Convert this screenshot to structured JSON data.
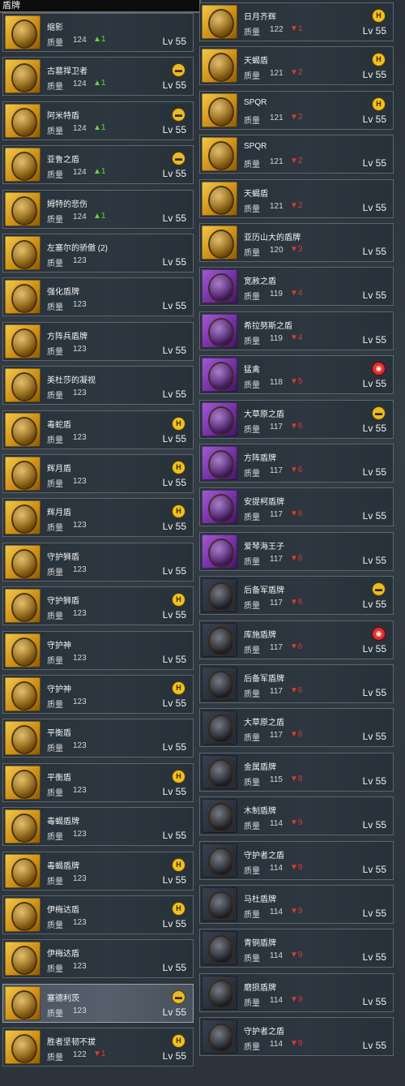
{
  "title": "盾牌",
  "quality_label": "质量",
  "left_items": [
    {
      "name": "缩影",
      "quality": "124",
      "delta": "▲1",
      "dir": "up",
      "level": "Lv 55",
      "rarity": "legend",
      "badge": ""
    },
    {
      "name": "古墓捍卫者",
      "quality": "124",
      "delta": "▲1",
      "dir": "up",
      "level": "Lv 55",
      "rarity": "legend",
      "badge": "chest"
    },
    {
      "name": "阿米特盾",
      "quality": "124",
      "delta": "▲1",
      "dir": "up",
      "level": "Lv 55",
      "rarity": "legend",
      "badge": "chest"
    },
    {
      "name": "亚鲁之盾",
      "quality": "124",
      "delta": "▲1",
      "dir": "up",
      "level": "Lv 55",
      "rarity": "legend",
      "badge": "chest"
    },
    {
      "name": "姆特的悲伤",
      "quality": "124",
      "delta": "▲1",
      "dir": "up",
      "level": "Lv 55",
      "rarity": "legend",
      "badge": ""
    },
    {
      "name": "左塞尔的骄傲 (2)",
      "quality": "123",
      "delta": "",
      "dir": "",
      "level": "Lv 55",
      "rarity": "legend",
      "badge": ""
    },
    {
      "name": "强化盾牌",
      "quality": "123",
      "delta": "",
      "dir": "",
      "level": "Lv 55",
      "rarity": "legend",
      "badge": ""
    },
    {
      "name": "方阵兵盾牌",
      "quality": "123",
      "delta": "",
      "dir": "",
      "level": "Lv 55",
      "rarity": "legend",
      "badge": ""
    },
    {
      "name": "美杜莎的凝视",
      "quality": "123",
      "delta": "",
      "dir": "",
      "level": "Lv 55",
      "rarity": "legend",
      "badge": ""
    },
    {
      "name": "毒蛇盾",
      "quality": "123",
      "delta": "",
      "dir": "",
      "level": "Lv 55",
      "rarity": "legend",
      "badge": "h"
    },
    {
      "name": "辉月盾",
      "quality": "123",
      "delta": "",
      "dir": "",
      "level": "Lv 55",
      "rarity": "legend",
      "badge": "h"
    },
    {
      "name": "辉月盾",
      "quality": "123",
      "delta": "",
      "dir": "",
      "level": "Lv 55",
      "rarity": "legend",
      "badge": "h"
    },
    {
      "name": "守护狮盾",
      "quality": "123",
      "delta": "",
      "dir": "",
      "level": "Lv 55",
      "rarity": "legend",
      "badge": ""
    },
    {
      "name": "守护狮盾",
      "quality": "123",
      "delta": "",
      "dir": "",
      "level": "Lv 55",
      "rarity": "legend",
      "badge": "h"
    },
    {
      "name": "守护神",
      "quality": "123",
      "delta": "",
      "dir": "",
      "level": "Lv 55",
      "rarity": "legend",
      "badge": ""
    },
    {
      "name": "守护神",
      "quality": "123",
      "delta": "",
      "dir": "",
      "level": "Lv 55",
      "rarity": "legend",
      "badge": "h"
    },
    {
      "name": "平衡盾",
      "quality": "123",
      "delta": "",
      "dir": "",
      "level": "Lv 55",
      "rarity": "legend",
      "badge": ""
    },
    {
      "name": "平衡盾",
      "quality": "123",
      "delta": "",
      "dir": "",
      "level": "Lv 55",
      "rarity": "legend",
      "badge": "h"
    },
    {
      "name": "毒蝎盾牌",
      "quality": "123",
      "delta": "",
      "dir": "",
      "level": "Lv 55",
      "rarity": "legend",
      "badge": ""
    },
    {
      "name": "毒蝎盾牌",
      "quality": "123",
      "delta": "",
      "dir": "",
      "level": "Lv 55",
      "rarity": "legend",
      "badge": "h"
    },
    {
      "name": "伊梅达盾",
      "quality": "123",
      "delta": "",
      "dir": "",
      "level": "Lv 55",
      "rarity": "legend",
      "badge": "h"
    },
    {
      "name": "伊梅达盾",
      "quality": "123",
      "delta": "",
      "dir": "",
      "level": "Lv 55",
      "rarity": "legend",
      "badge": ""
    },
    {
      "name": "塞德利茨",
      "quality": "123",
      "delta": "",
      "dir": "",
      "level": "Lv 55",
      "rarity": "legend",
      "badge": "chest",
      "selected": true
    },
    {
      "name": "胜者坚韧不拔",
      "quality": "122",
      "delta": "▼1",
      "dir": "down",
      "level": "Lv 55",
      "rarity": "legend",
      "badge": "h"
    }
  ],
  "right_items": [
    {
      "name": "日月齐辉",
      "quality": "122",
      "delta": "▼1",
      "dir": "down",
      "level": "Lv 55",
      "rarity": "legend",
      "badge": "h"
    },
    {
      "name": "天蝎盾",
      "quality": "121",
      "delta": "▼2",
      "dir": "down",
      "level": "Lv 55",
      "rarity": "legend",
      "badge": "h"
    },
    {
      "name": "SPQR",
      "quality": "121",
      "delta": "▼2",
      "dir": "down",
      "level": "Lv 55",
      "rarity": "legend",
      "badge": "h"
    },
    {
      "name": "SPQR",
      "quality": "121",
      "delta": "▼2",
      "dir": "down",
      "level": "Lv 55",
      "rarity": "legend",
      "badge": ""
    },
    {
      "name": "天蝎盾",
      "quality": "121",
      "delta": "▼2",
      "dir": "down",
      "level": "Lv 55",
      "rarity": "legend",
      "badge": ""
    },
    {
      "name": "亚历山大的盾牌",
      "quality": "120",
      "delta": "▼3",
      "dir": "down",
      "level": "Lv 55",
      "rarity": "legend",
      "badge": ""
    },
    {
      "name": "宽赦之盾",
      "quality": "119",
      "delta": "▼4",
      "dir": "down",
      "level": "Lv 55",
      "rarity": "epic",
      "badge": ""
    },
    {
      "name": "希拉努斯之盾",
      "quality": "119",
      "delta": "▼4",
      "dir": "down",
      "level": "Lv 55",
      "rarity": "epic",
      "badge": ""
    },
    {
      "name": "猛禽",
      "quality": "118",
      "delta": "▼5",
      "dir": "down",
      "level": "Lv 55",
      "rarity": "epic",
      "badge": "spiral"
    },
    {
      "name": "大草原之盾",
      "quality": "117",
      "delta": "▼6",
      "dir": "down",
      "level": "Lv 55",
      "rarity": "epic",
      "badge": "chest"
    },
    {
      "name": "方阵盾牌",
      "quality": "117",
      "delta": "▼6",
      "dir": "down",
      "level": "Lv 55",
      "rarity": "epic",
      "badge": ""
    },
    {
      "name": "安提柯盾牌",
      "quality": "117",
      "delta": "▼6",
      "dir": "down",
      "level": "Lv 55",
      "rarity": "epic",
      "badge": ""
    },
    {
      "name": "爱琴海王子",
      "quality": "117",
      "delta": "▼6",
      "dir": "down",
      "level": "Lv 55",
      "rarity": "epic",
      "badge": ""
    },
    {
      "name": "后备军盾牌",
      "quality": "117",
      "delta": "▼6",
      "dir": "down",
      "level": "Lv 55",
      "rarity": "rare",
      "badge": "chest"
    },
    {
      "name": "库施盾牌",
      "quality": "117",
      "delta": "▼6",
      "dir": "down",
      "level": "Lv 55",
      "rarity": "rare",
      "badge": "spiral"
    },
    {
      "name": "后备军盾牌",
      "quality": "117",
      "delta": "▼6",
      "dir": "down",
      "level": "Lv 55",
      "rarity": "rare",
      "badge": ""
    },
    {
      "name": "大草原之盾",
      "quality": "117",
      "delta": "▼6",
      "dir": "down",
      "level": "Lv 55",
      "rarity": "rare",
      "badge": ""
    },
    {
      "name": "金属盾牌",
      "quality": "115",
      "delta": "▼8",
      "dir": "down",
      "level": "Lv 55",
      "rarity": "rare",
      "badge": ""
    },
    {
      "name": "木制盾牌",
      "quality": "114",
      "delta": "▼9",
      "dir": "down",
      "level": "Lv 55",
      "rarity": "rare",
      "badge": ""
    },
    {
      "name": "守护者之盾",
      "quality": "114",
      "delta": "▼9",
      "dir": "down",
      "level": "Lv 55",
      "rarity": "rare",
      "badge": ""
    },
    {
      "name": "马杜盾牌",
      "quality": "114",
      "delta": "▼9",
      "dir": "down",
      "level": "Lv 55",
      "rarity": "rare",
      "badge": ""
    },
    {
      "name": "青铜盾牌",
      "quality": "114",
      "delta": "▼9",
      "dir": "down",
      "level": "Lv 55",
      "rarity": "rare",
      "badge": ""
    },
    {
      "name": "磨损盾牌",
      "quality": "114",
      "delta": "▼9",
      "dir": "down",
      "level": "Lv 55",
      "rarity": "rare",
      "badge": ""
    },
    {
      "name": "守护者之盾",
      "quality": "114",
      "delta": "▼9",
      "dir": "down",
      "level": "Lv 55",
      "rarity": "rare",
      "badge": ""
    }
  ],
  "badge_glyphs": {
    "h": "H",
    "chest": "▬",
    "spiral": "◉"
  },
  "colors": {
    "up": "#6fd03a",
    "down": "#e03a2a",
    "legendary": "#f3c94a",
    "epic": "#a15bd0",
    "rare": "#3a4150"
  }
}
